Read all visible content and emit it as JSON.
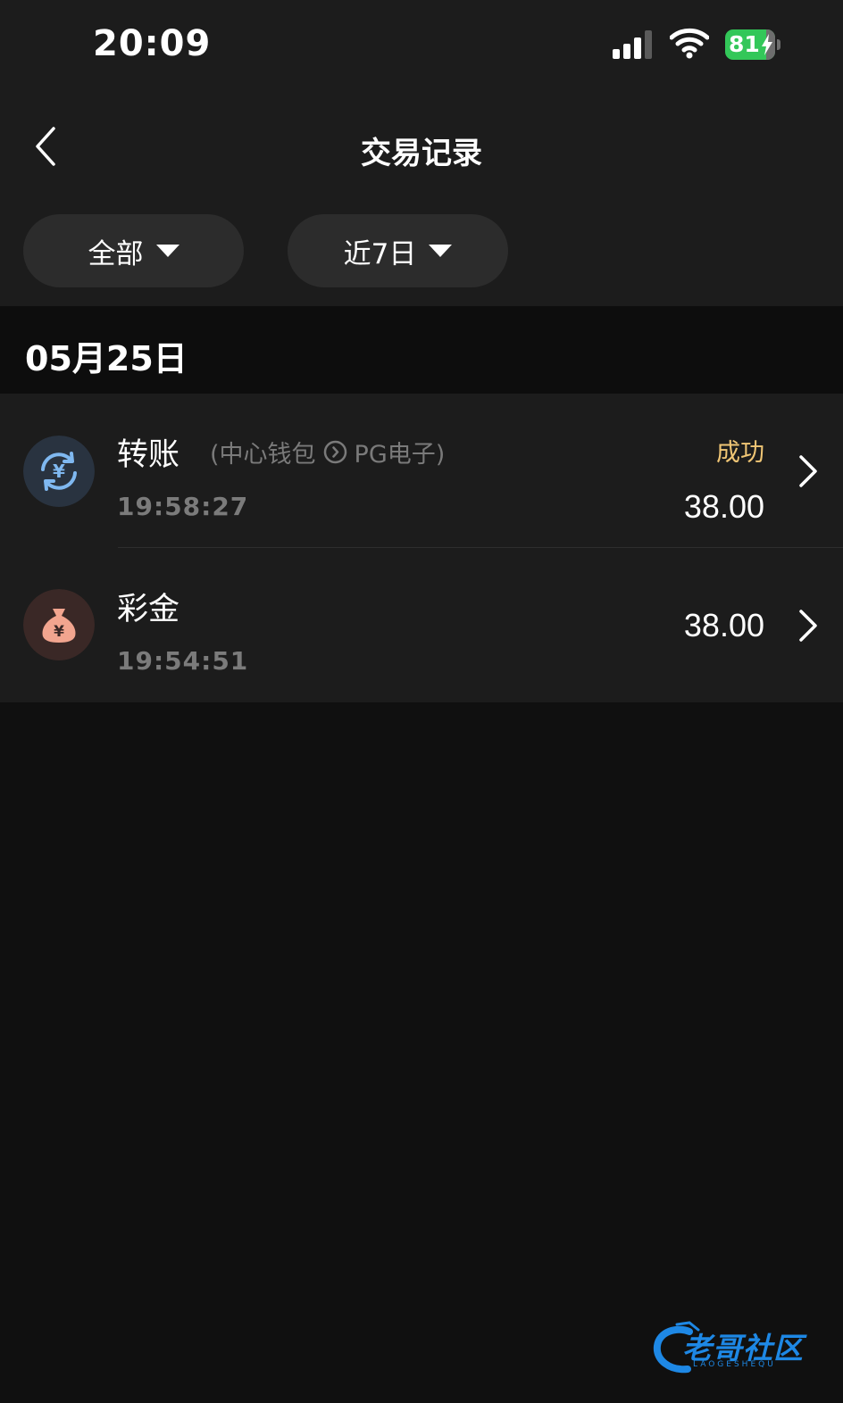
{
  "status_bar": {
    "time": "20:09",
    "battery": "81"
  },
  "nav": {
    "title": "交易记录"
  },
  "filters": [
    {
      "label": "全部"
    },
    {
      "label": "近7日"
    }
  ],
  "date_group": {
    "date": "05月25日"
  },
  "transactions": [
    {
      "title": "转账",
      "from": "(中心钱包",
      "to": "PG电子)",
      "time": "19:58:27",
      "status": "成功",
      "amount": "38.00",
      "icon": "currency-transfer-icon",
      "icon_bg": "#293340",
      "icon_color": "#7fb8f0"
    },
    {
      "title": "彩金",
      "time": "19:54:51",
      "amount": "38.00",
      "icon": "money-bag-icon",
      "icon_bg": "#3a2826",
      "icon_color": "#f2a58f"
    }
  ],
  "watermark": {
    "text": "老哥社区",
    "sub": "LAOGESHEQU"
  },
  "colors": {
    "success": "#f0c675",
    "battery": "#33c759",
    "watermark": "#1e88e5"
  }
}
